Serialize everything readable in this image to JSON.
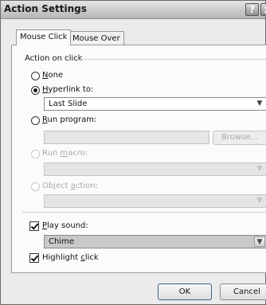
{
  "window": {
    "title": "Action Settings",
    "help_glyph": "?",
    "close_glyph": "x"
  },
  "tabs": [
    {
      "label": "Mouse Click",
      "active": true
    },
    {
      "label": "Mouse Over",
      "active": false
    }
  ],
  "group": {
    "label": "Action on click"
  },
  "options": {
    "none": {
      "prefix": "",
      "accel": "N",
      "rest": "one"
    },
    "hyperlink": {
      "prefix": "",
      "accel": "H",
      "rest": "yperlink to:",
      "value": "Last Slide"
    },
    "run_program": {
      "prefix": "",
      "accel": "R",
      "rest": "un program:",
      "value": "",
      "browse_label": "Browse..."
    },
    "run_macro": {
      "prefix": "Run ",
      "accel": "m",
      "rest": "acro:",
      "value": ""
    },
    "object_action": {
      "prefix": "Object ",
      "accel": "a",
      "rest": "ction:",
      "value": ""
    }
  },
  "play_sound": {
    "prefix": "",
    "accel": "P",
    "rest": "lay sound:",
    "checked": true,
    "value": "Chime"
  },
  "highlight": {
    "prefix": "Highlight ",
    "accel": "c",
    "rest": "lick",
    "checked": true
  },
  "buttons": {
    "ok": "OK",
    "cancel": "Cancel"
  }
}
